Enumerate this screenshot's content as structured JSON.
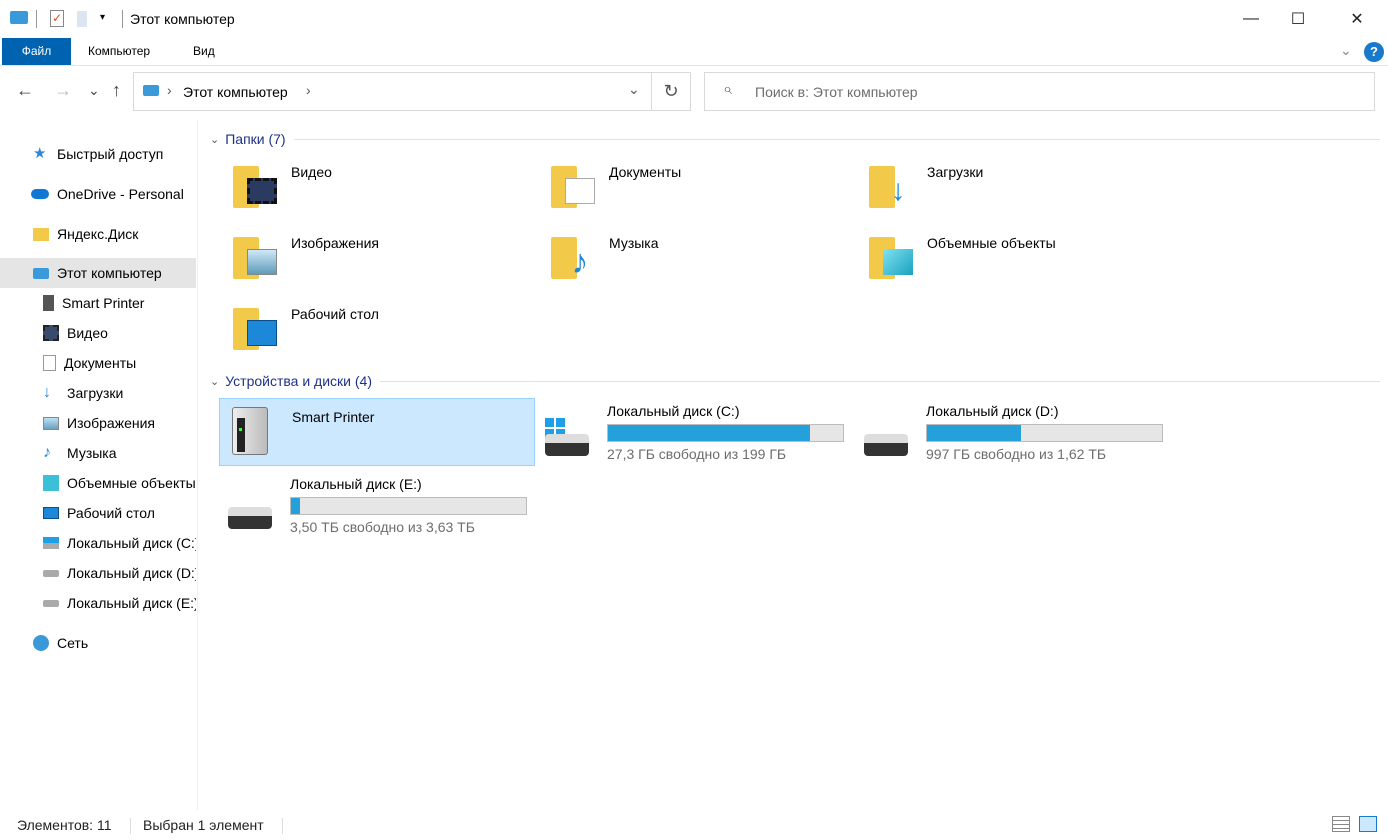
{
  "window": {
    "title": "Этот компьютер",
    "minimize": "—",
    "maximize": "☐",
    "close": "✕"
  },
  "ribbon": {
    "tabs": [
      "Файл",
      "Компьютер",
      "Вид"
    ],
    "help": "?"
  },
  "nav": {
    "back": "←",
    "forward": "→",
    "recent": "⌄",
    "up": "↑"
  },
  "address": {
    "path": "Этот компьютер",
    "sep": "›",
    "dropdown": "⌄",
    "refresh": "↻"
  },
  "search": {
    "placeholder": "Поиск в: Этот компьютер",
    "icon": "⌕"
  },
  "sidebar": {
    "items": [
      {
        "label": "Быстрый доступ",
        "icon": "star-icon"
      },
      {
        "label": "OneDrive - Personal",
        "icon": "cloud-icon"
      },
      {
        "label": "Яндекс.Диск",
        "icon": "folder-icon"
      },
      {
        "label": "Этот компьютер",
        "icon": "computer-icon"
      },
      {
        "label": "Smart Printer",
        "icon": "printer-drive-icon"
      },
      {
        "label": "Видео",
        "icon": "video-icon"
      },
      {
        "label": "Документы",
        "icon": "document-icon"
      },
      {
        "label": "Загрузки",
        "icon": "download-icon"
      },
      {
        "label": "Изображения",
        "icon": "image-icon"
      },
      {
        "label": "Музыка",
        "icon": "music-icon"
      },
      {
        "label": "Объемные объекты",
        "icon": "cube-icon"
      },
      {
        "label": "Рабочий стол",
        "icon": "desktop-icon"
      },
      {
        "label": "Локальный диск (C:)",
        "icon": "drive-icon"
      },
      {
        "label": "Локальный диск (D:)",
        "icon": "drive-icon"
      },
      {
        "label": "Локальный диск (E:)",
        "icon": "drive-icon"
      },
      {
        "label": "Сеть",
        "icon": "network-icon"
      }
    ]
  },
  "folders": {
    "header": "Папки (7)",
    "items": [
      "Видео",
      "Документы",
      "Загрузки",
      "Изображения",
      "Музыка",
      "Объемные объекты",
      "Рабочий стол"
    ]
  },
  "devices": {
    "header": "Устройства и диски (4)",
    "items": [
      {
        "name": "Smart Printer"
      },
      {
        "name": "Локальный диск (C:)",
        "free": "27,3 ГБ свободно из 199 ГБ",
        "used_pct": 86
      },
      {
        "name": "Локальный диск (D:)",
        "free": "997 ГБ свободно из 1,62 ТБ",
        "used_pct": 40
      },
      {
        "name": "Локальный диск (E:)",
        "free": "3,50 ТБ свободно из 3,63 ТБ",
        "used_pct": 4
      }
    ]
  },
  "status": {
    "count": "Элементов: 11",
    "selected": "Выбран 1 элемент"
  },
  "colors": {
    "accent": "#0063b1",
    "bar": "#26a0da",
    "selection": "#cce8ff"
  }
}
